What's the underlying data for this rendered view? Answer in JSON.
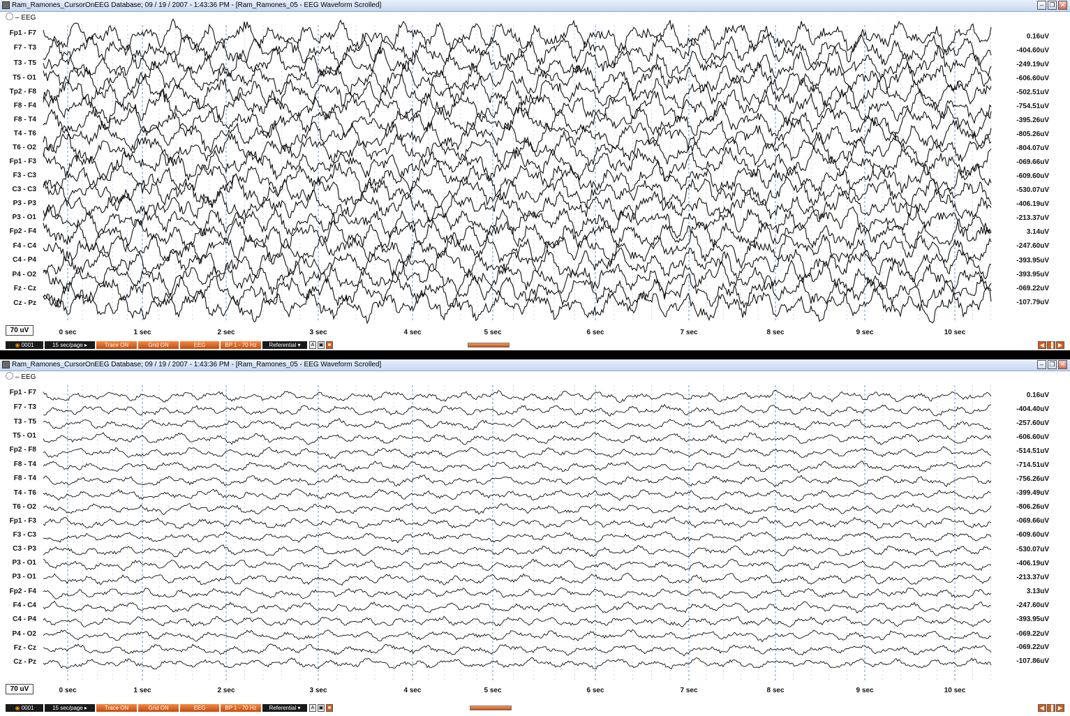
{
  "app": {
    "title": "Ram_Ramones_CursorOnEEG Database; 09 / 19 / 2007 - 1:43:36 PM - [Ram_Ramones_05 - EEG Waveform Scrolled]",
    "section_label": "EEG",
    "window_buttons": {
      "minimize": "–",
      "restore": "❐",
      "close": "✕"
    }
  },
  "time_ticks": [
    "0 sec",
    "1 sec",
    "2 sec",
    "3 sec",
    "4 sec",
    "5 sec",
    "6 sec",
    "7 sec",
    "8 sec",
    "9 sec",
    "10 sec"
  ],
  "status": {
    "page": "0001",
    "speed": "15 sec/page",
    "trace": "Trace ON",
    "grid": "Grid ON",
    "mode": "EEG",
    "filter": "BP 1 - 70 Hz",
    "montage": "Referential"
  },
  "panels": [
    {
      "scale": "70 uV",
      "trace_amplitude": "high",
      "channels": [
        {
          "label": "Fp1 - F7",
          "value": "0.16uV"
        },
        {
          "label": "F7 - T3",
          "value": "-404.60uV"
        },
        {
          "label": "T3 - T5",
          "value": "-249.19uV"
        },
        {
          "label": "T5 - O1",
          "value": "-606.60uV"
        },
        {
          "label": "Tp2 - F8",
          "value": "-502.51uV"
        },
        {
          "label": "F8 - F4",
          "value": "-754.51uV"
        },
        {
          "label": "F8 - T4",
          "value": "-395.26uV"
        },
        {
          "label": "T4 - T6",
          "value": "-805.26uV"
        },
        {
          "label": "T6 - O2",
          "value": "-804.07uV"
        },
        {
          "label": "Fp1 - F3",
          "value": "-069.66uV"
        },
        {
          "label": "F3 - C3",
          "value": "-609.60uV"
        },
        {
          "label": "C3 - C3",
          "value": "-530.07uV"
        },
        {
          "label": "P3 - P3",
          "value": "-406.19uV"
        },
        {
          "label": "P3 - O1",
          "value": "-213.37uV"
        },
        {
          "label": "Fp2 - F4",
          "value": "3.14uV"
        },
        {
          "label": "F4 - C4",
          "value": "-247.60uV"
        },
        {
          "label": "C4 - P4",
          "value": "-393.95uV"
        },
        {
          "label": "P4 - O2",
          "value": "-393.95uV"
        },
        {
          "label": "Fz - Cz",
          "value": "-069.22uV"
        },
        {
          "label": "Cz - Pz",
          "value": "-107.79uV"
        }
      ]
    },
    {
      "scale": "70 uV",
      "trace_amplitude": "low",
      "channels": [
        {
          "label": "Fp1 - F7",
          "value": "0.16uV"
        },
        {
          "label": "F7 - T3",
          "value": "-404.40uV"
        },
        {
          "label": "T3 - T5",
          "value": "-257.60uV"
        },
        {
          "label": "T5 - O1",
          "value": "-606.60uV"
        },
        {
          "label": "Fp2 - F8",
          "value": "-514.51uV"
        },
        {
          "label": "F8 - T4",
          "value": "-714.51uV"
        },
        {
          "label": "F8 - T4",
          "value": "-756.26uV"
        },
        {
          "label": "T4 - T6",
          "value": "-399.49uV"
        },
        {
          "label": "T6 - O2",
          "value": "-806.26uV"
        },
        {
          "label": "Fp1 - F3",
          "value": "-069.66uV"
        },
        {
          "label": "F3 - C3",
          "value": "-609.60uV"
        },
        {
          "label": "C3 - P3",
          "value": "-530.07uV"
        },
        {
          "label": "P3 - O1",
          "value": "-406.19uV"
        },
        {
          "label": "P3 - O1",
          "value": "-213.37uV"
        },
        {
          "label": "Fp2 - F4",
          "value": "3.13uV"
        },
        {
          "label": "F4 - C4",
          "value": "-247.60uV"
        },
        {
          "label": "C4 - P4",
          "value": "-393.95uV"
        },
        {
          "label": "P4 - O2",
          "value": "-069.22uV"
        },
        {
          "label": "Fz - Cz",
          "value": "-069.22uV"
        },
        {
          "label": "Cz - Pz",
          "value": "-107.86uV"
        }
      ]
    }
  ]
}
